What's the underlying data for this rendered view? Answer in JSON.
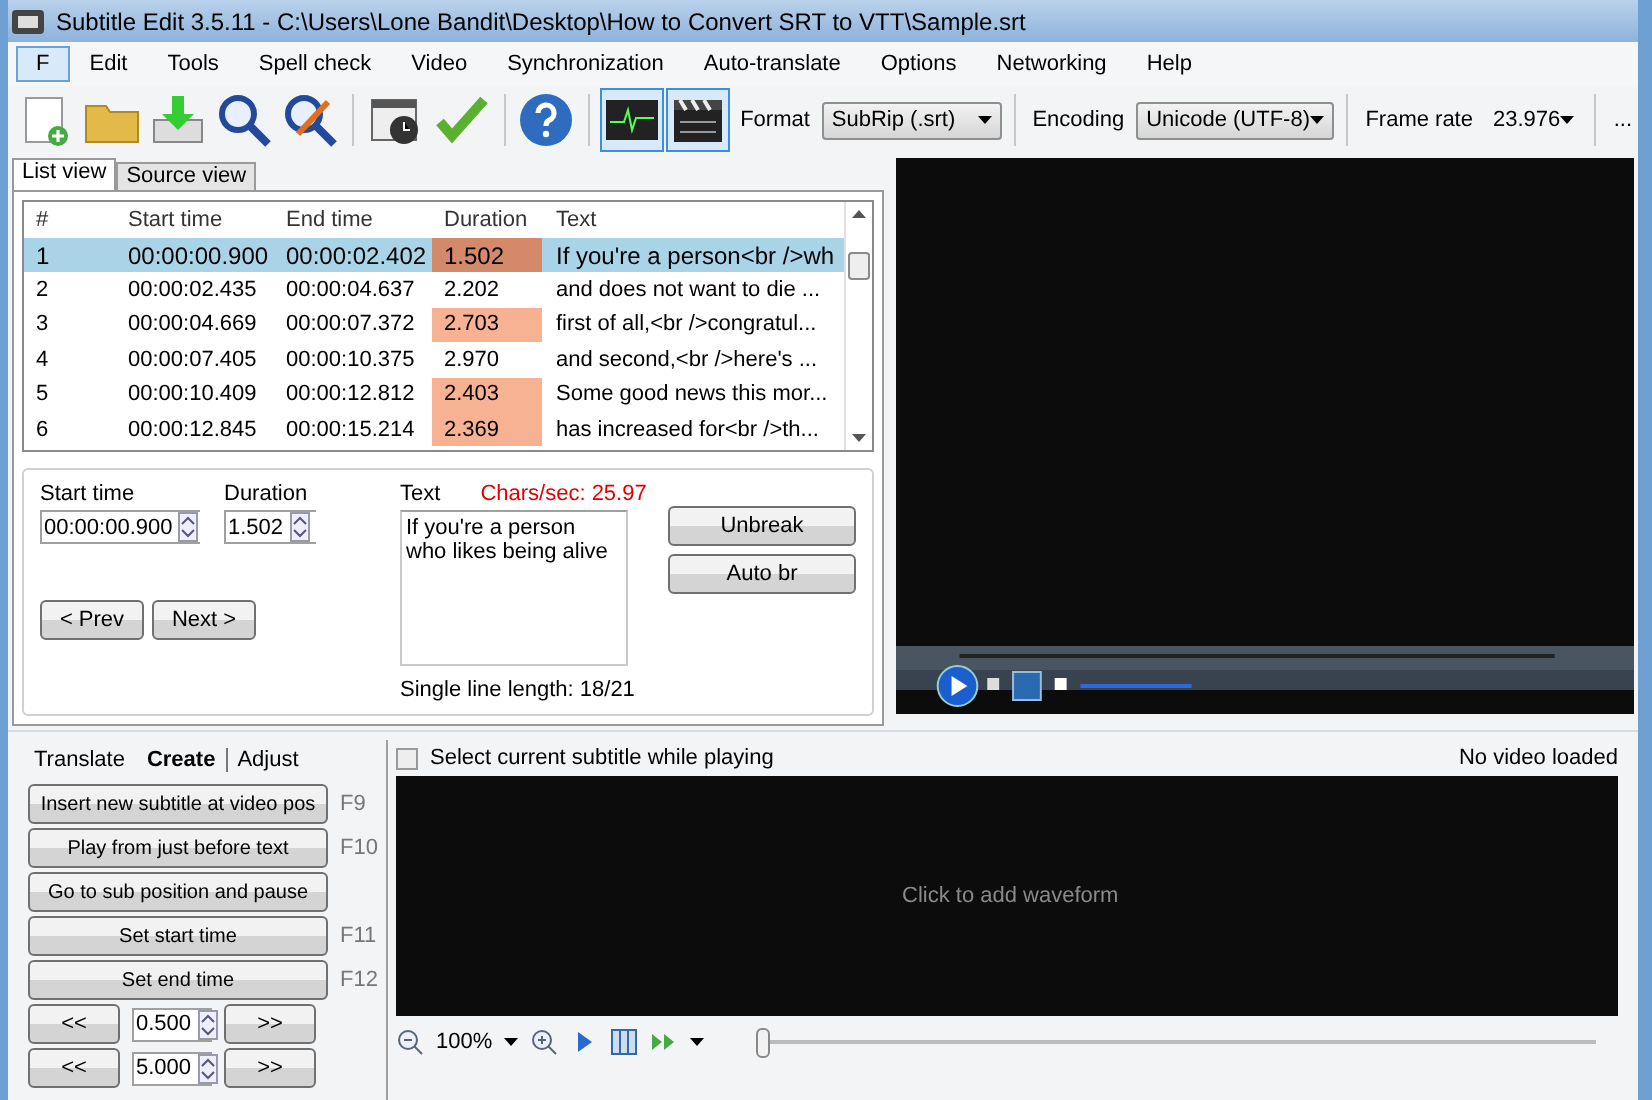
{
  "window": {
    "title": "Subtitle Edit 3.5.11 - C:\\Users\\Lone Bandit\\Desktop\\How to Convert SRT to VTT\\Sample.srt"
  },
  "menu": [
    {
      "label": "F",
      "selected": true
    },
    {
      "label": "Edit",
      "selected": false
    },
    {
      "label": "Tools",
      "selected": false
    },
    {
      "label": "Spell check",
      "selected": false
    },
    {
      "label": "Video",
      "selected": false
    },
    {
      "label": "Synchronization",
      "selected": false
    },
    {
      "label": "Auto-translate",
      "selected": false
    },
    {
      "label": "Options",
      "selected": false
    },
    {
      "label": "Networking",
      "selected": false
    },
    {
      "label": "Help",
      "selected": false
    }
  ],
  "toolbar": {
    "format_label": "Format",
    "format": "SubRip (.srt)",
    "encoding_label": "Encoding",
    "encoding": "Unicode (UTF-8)",
    "frame_rate_label": "Frame rate",
    "frame_rate": "23.976",
    "more": "...",
    "waveform_on": true,
    "video_on": true
  },
  "view_tabs": [
    {
      "label": "List view",
      "selected": true
    },
    {
      "label": "Source view",
      "selected": false
    }
  ],
  "table": {
    "columns": [
      "#",
      "Start time",
      "End time",
      "Duration",
      "Text"
    ],
    "rows": [
      {
        "cells": [
          "1",
          "00:00:00.900",
          "00:00:02.402",
          "1.502",
          "If you're a person<br />wh"
        ],
        "selected": true,
        "duration_warning": true
      },
      {
        "cells": [
          "2",
          "00:00:02.435",
          "00:00:04.637",
          "2.202",
          "and does not want to die ..."
        ],
        "selected": false,
        "duration_warning": false
      },
      {
        "cells": [
          "3",
          "00:00:04.669",
          "00:00:07.372",
          "2.703",
          "first of all,<br />congratul..."
        ],
        "selected": false,
        "duration_warning": true
      },
      {
        "cells": [
          "4",
          "00:00:07.405",
          "00:00:10.375",
          "2.970",
          "and second,<br />here's ..."
        ],
        "selected": false,
        "duration_warning": false
      },
      {
        "cells": [
          "5",
          "00:00:10.409",
          "00:00:12.812",
          "2.403",
          "Some good news this mor..."
        ],
        "selected": false,
        "duration_warning": true
      },
      {
        "cells": [
          "6",
          "00:00:12.845",
          "00:00:15.214",
          "2.369",
          "has increased for<br />th..."
        ],
        "selected": false,
        "duration_warning": true
      }
    ]
  },
  "editor": {
    "start_label": "Start time",
    "start": "00:00:00.900",
    "duration_label": "Duration",
    "duration": "1.502",
    "text_label": "Text",
    "chars_per_sec": "Chars/sec: 25.97",
    "text_lines": [
      "If you're a person",
      "who likes being alive"
    ],
    "line_length": "Single line length: 18/21",
    "buttons": [
      "Unbreak",
      "Auto br"
    ],
    "nav": [
      "< Prev",
      "Next >"
    ]
  },
  "bottom_tabs": [
    {
      "label": "Translate",
      "selected": false
    },
    {
      "label": "Create",
      "selected": true
    },
    {
      "label": "Adjust",
      "selected": false
    }
  ],
  "create_buttons": [
    {
      "label": "Insert new subtitle at video pos",
      "shortcut": "F9"
    },
    {
      "label": "Play from just before text",
      "shortcut": "F10"
    },
    {
      "label": "Go to sub position and pause"
    },
    {
      "label": "Set start time",
      "shortcut": "F11"
    },
    {
      "label": "Set end time",
      "shortcut": "F12"
    }
  ],
  "steppers": [
    {
      "back": "<<",
      "value": "0.500",
      "forward": ">>"
    },
    {
      "back": "<<",
      "value": "5.000",
      "forward": ">>"
    }
  ],
  "select_while_playing": {
    "label": "Select current subtitle while playing",
    "checked": false
  },
  "video_status": "No video loaded",
  "waveform": {
    "hint": "Click to add waveform",
    "zoom": "100%",
    "zoom_slider": {
      "level": 0
    }
  }
}
